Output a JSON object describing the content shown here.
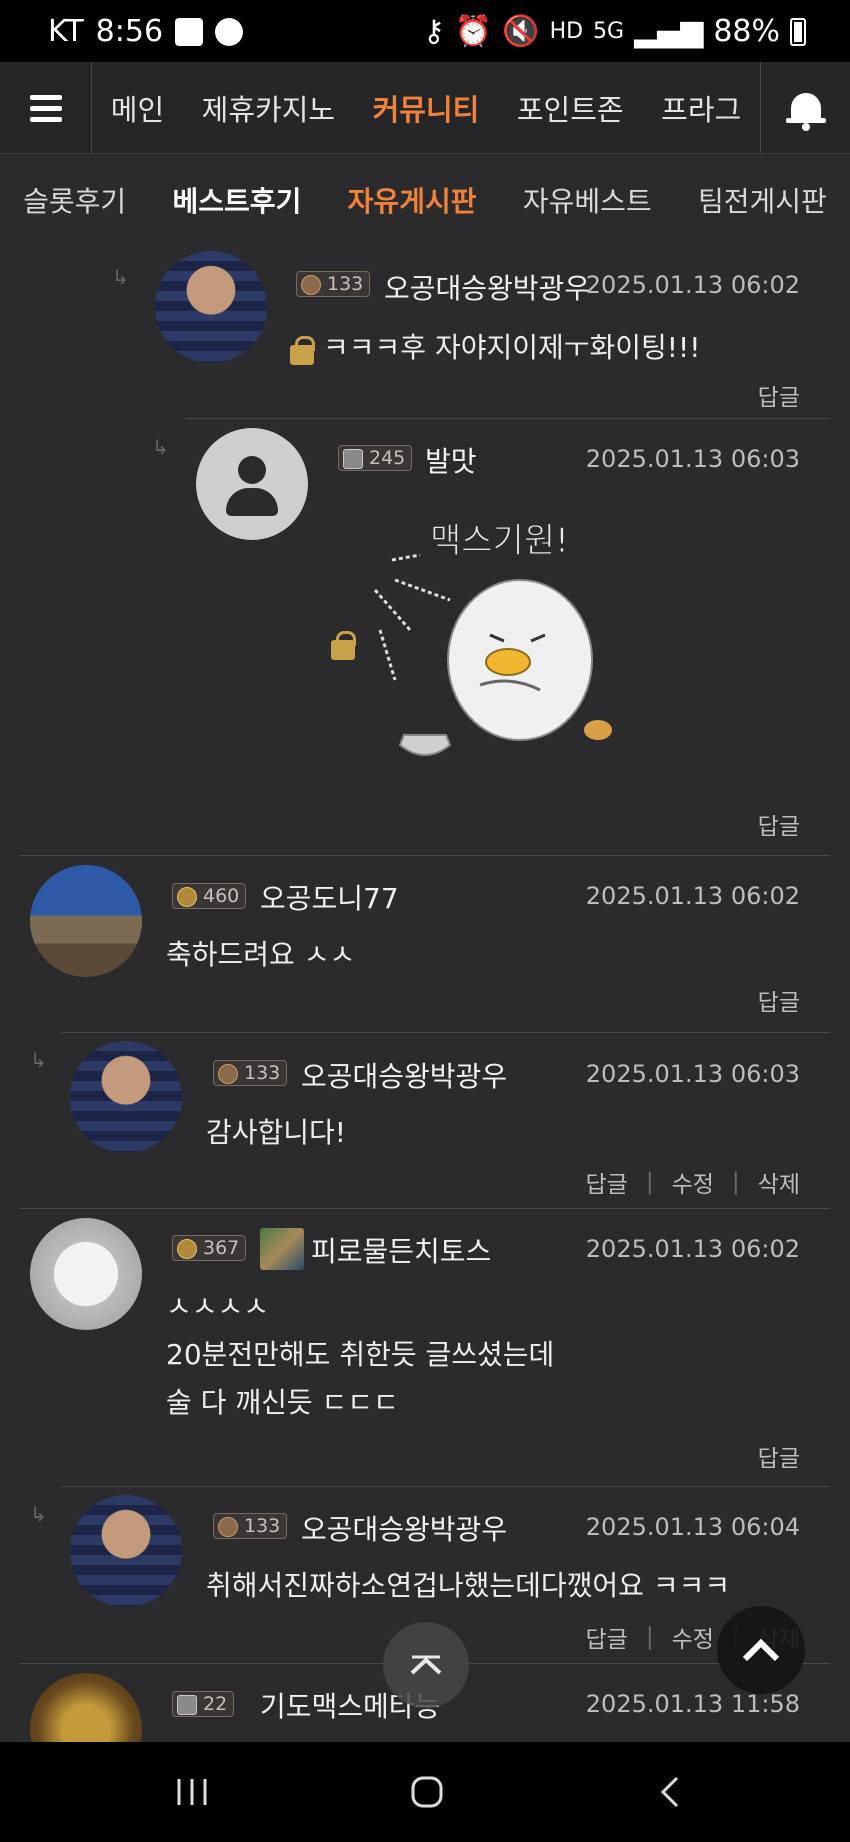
{
  "status": {
    "carrier": "KT",
    "time": "8:56",
    "network": "HD",
    "network_type": "5G",
    "battery": "88%"
  },
  "mainnav": {
    "items": [
      "메인",
      "제휴카지노",
      "커뮤니티",
      "포인트존",
      "프라그"
    ],
    "active": "커뮤니티"
  },
  "subnav": {
    "items": [
      "슬롯후기",
      "베스트후기",
      "자유게시판",
      "자유베스트",
      "팀전게시판"
    ],
    "active": "자유게시판"
  },
  "comments": [
    {
      "level": "133",
      "nick": "오공대승왕박광우",
      "date": "2025.01.13 06:02",
      "text": "ㅋㅋㅋ후 자야지이제ㅜ화이팅!!!",
      "reply": "답글"
    },
    {
      "level": "245",
      "nick": "발맛",
      "date": "2025.01.13 06:03",
      "sticker_text": "맥스기원!",
      "reply": "답글"
    },
    {
      "level": "460",
      "nick": "오공도니77",
      "date": "2025.01.13 06:02",
      "text": "축하드려요 ㅅㅅ",
      "reply": "답글"
    },
    {
      "level": "133",
      "nick": "오공대승왕박광우",
      "date": "2025.01.13 06:03",
      "text": "감사합니다!",
      "reply": "답글",
      "edit": "수정",
      "delete": "삭제"
    },
    {
      "level": "367",
      "nick": "피로물든치토스",
      "date": "2025.01.13 06:02",
      "lines": [
        "ㅅㅅㅅㅅ",
        "20분전만해도 취한듯 글쓰셨는데",
        "술 다 깨신듯 ㄷㄷㄷ"
      ],
      "reply": "답글"
    },
    {
      "level": "133",
      "nick": "오공대승왕박광우",
      "date": "2025.01.13 06:04",
      "text": "취해서진짜하소연겁나했는데다깼어요 ㅋㅋㅋ",
      "reply": "답글",
      "edit": "수정",
      "delete": "삭제"
    },
    {
      "level": "22",
      "nick": "기도맥스메타능",
      "date": "2025.01.13 11:58"
    }
  ]
}
